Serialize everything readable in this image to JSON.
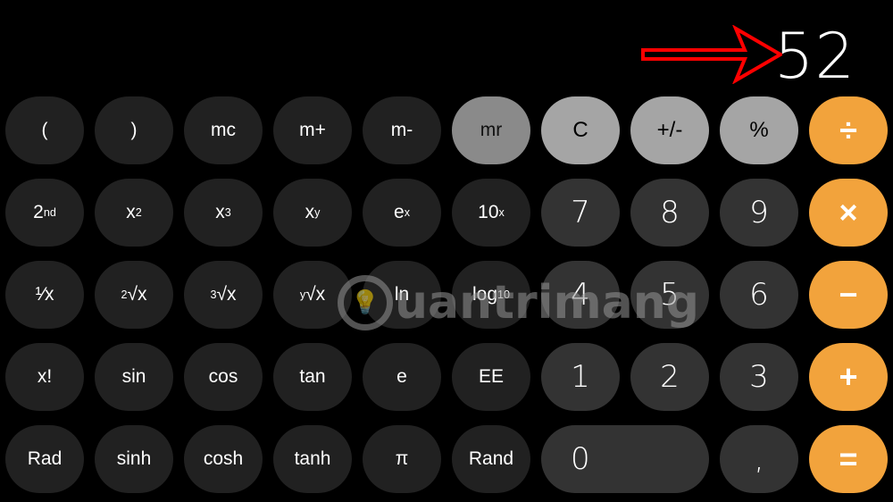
{
  "display": {
    "value": "52"
  },
  "annotation": {
    "arrow_color": "#ff0000"
  },
  "colors": {
    "function_key": "#212121",
    "digit_key": "#333333",
    "utility_key": "#a5a5a5",
    "memory_recall_key": "#8a8a8a",
    "operator_key": "#f2a33c",
    "background": "#000000"
  },
  "keys": {
    "row1": [
      {
        "label": "("
      },
      {
        "label": ")"
      },
      {
        "label": "mc"
      },
      {
        "label": "m+"
      },
      {
        "label": "m-"
      },
      {
        "label": "mr"
      },
      {
        "label": "C"
      },
      {
        "label": "+/-"
      },
      {
        "label": "%"
      },
      {
        "label": "÷"
      }
    ],
    "row2": [
      {
        "label": "2",
        "sup": "nd"
      },
      {
        "label": "x",
        "sup": "2"
      },
      {
        "label": "x",
        "sup": "3"
      },
      {
        "label": "x",
        "sup": "y"
      },
      {
        "label": "e",
        "sup": "x"
      },
      {
        "label": "10",
        "sup": "x"
      },
      {
        "label": "7"
      },
      {
        "label": "8"
      },
      {
        "label": "9"
      },
      {
        "label": "×"
      }
    ],
    "row3": [
      {
        "label": "¹⁄x"
      },
      {
        "label": "√x",
        "sup": "2"
      },
      {
        "label": "√x",
        "sup": "3"
      },
      {
        "label": "√x",
        "sup": "y"
      },
      {
        "label": "ln"
      },
      {
        "label": "log",
        "sub": "10"
      },
      {
        "label": "4"
      },
      {
        "label": "5"
      },
      {
        "label": "6"
      },
      {
        "label": "−"
      }
    ],
    "row4": [
      {
        "label": "x!"
      },
      {
        "label": "sin"
      },
      {
        "label": "cos"
      },
      {
        "label": "tan"
      },
      {
        "label": "e"
      },
      {
        "label": "EE"
      },
      {
        "label": "1"
      },
      {
        "label": "2"
      },
      {
        "label": "3"
      },
      {
        "label": "+"
      }
    ],
    "row5": [
      {
        "label": "Rad"
      },
      {
        "label": "sinh"
      },
      {
        "label": "cosh"
      },
      {
        "label": "tanh"
      },
      {
        "label": "π"
      },
      {
        "label": "Rand"
      },
      {
        "label": "0"
      },
      {
        "label": ","
      },
      {
        "label": "="
      }
    ]
  },
  "watermark": {
    "text": "uantrimang",
    "logo_glyph": "💡"
  }
}
